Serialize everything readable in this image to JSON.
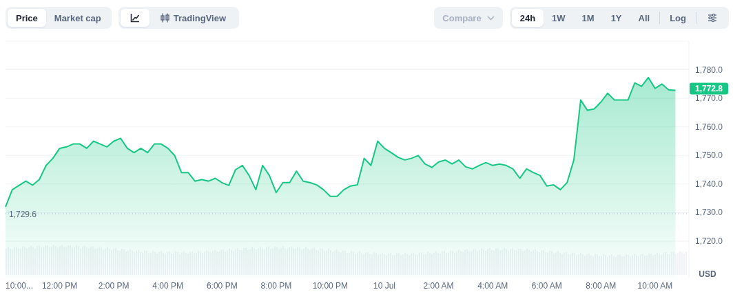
{
  "chart_type_tabs": [
    {
      "label": "Price",
      "selected": true
    },
    {
      "label": "Market cap",
      "selected": false
    }
  ],
  "view_tabs": [
    {
      "kind": "line",
      "selected": true
    },
    {
      "kind": "tradingview",
      "label": "TradingView",
      "selected": false
    }
  ],
  "compare": {
    "label": "Compare",
    "disabled": true
  },
  "range_tabs": [
    {
      "label": "24h",
      "selected": true
    },
    {
      "label": "1W",
      "selected": false
    },
    {
      "label": "1M",
      "selected": false
    },
    {
      "label": "1Y",
      "selected": false
    },
    {
      "label": "All",
      "selected": false
    }
  ],
  "scale_toggle": {
    "label": "Log"
  },
  "chart": {
    "currency": "USD",
    "price_tag": "1,772.8",
    "first_time_label": "10:00...",
    "chart_data": {
      "type": "area",
      "ylim": [
        1707,
        1790
      ],
      "categories": [
        null,
        null,
        null,
        null,
        null,
        null,
        null,
        null,
        "12:00 PM",
        null,
        null,
        null,
        null,
        null,
        null,
        null,
        "2:00 PM",
        null,
        null,
        null,
        null,
        null,
        null,
        null,
        "4:00 PM",
        null,
        null,
        null,
        null,
        null,
        null,
        null,
        "6:00 PM",
        null,
        null,
        null,
        null,
        null,
        null,
        null,
        "8:00 PM",
        null,
        null,
        null,
        null,
        null,
        null,
        null,
        "10:00 PM",
        null,
        null,
        null,
        null,
        null,
        null,
        null,
        "10 Jul",
        null,
        null,
        null,
        null,
        null,
        null,
        null,
        "2:00 AM",
        null,
        null,
        null,
        null,
        null,
        null,
        null,
        "4:00 AM",
        null,
        null,
        null,
        null,
        null,
        null,
        null,
        "6:00 AM",
        null,
        null,
        null,
        null,
        null,
        null,
        null,
        "8:00 AM",
        null,
        null,
        null,
        null,
        null,
        null,
        null,
        "10:00 AM",
        null,
        null,
        null
      ],
      "series": [
        {
          "color": "#16c784",
          "values": [
            1732,
            1738,
            1739.5,
            1741,
            1739.6,
            1741.6,
            1746.5,
            1749,
            1752.5,
            1753,
            1754,
            1754,
            1752.5,
            1755,
            1754,
            1753,
            1755,
            1756,
            1752.5,
            1751,
            1752.5,
            1751,
            1754,
            1754,
            1752.5,
            1750,
            1744,
            1744,
            1741,
            1741.6,
            1741,
            1742,
            1740.5,
            1739.5,
            1745,
            1746.5,
            1743,
            1738,
            1746.5,
            1743,
            1737,
            1740.5,
            1740.5,
            1744.5,
            1741,
            1740.5,
            1739.7,
            1738,
            1735.7,
            1735.7,
            1738,
            1739.3,
            1739.7,
            1749,
            1746.5,
            1755,
            1752.5,
            1751,
            1749.4,
            1748.4,
            1749,
            1750,
            1747,
            1745.8,
            1747.7,
            1748.4,
            1747,
            1748.4,
            1746,
            1745.3,
            1746.5,
            1747.5,
            1746.5,
            1747,
            1746.5,
            1745.3,
            1742,
            1745.3,
            1744,
            1743,
            1739.3,
            1739.7,
            1738,
            1740.5,
            1748.4,
            1769.4,
            1765.8,
            1766.3,
            1768.7,
            1771.8,
            1769.4,
            1769.4,
            1769.4,
            1775.4,
            1774.2,
            1777.3,
            1773.5,
            1775,
            1773,
            1772.8
          ]
        }
      ],
      "yticks": [
        {
          "value": 1780,
          "label": "1,780.0"
        },
        {
          "value": 1770,
          "label": "1,770.0"
        },
        {
          "value": 1760,
          "label": "1,760.0"
        },
        {
          "value": 1750,
          "label": "1,750.0"
        },
        {
          "value": 1740,
          "label": "1,740.0"
        },
        {
          "value": 1730,
          "label": "1,730.0"
        },
        {
          "value": 1720,
          "label": "1,720.0"
        }
      ],
      "grid": true,
      "ref_lines": [
        {
          "axis": "y",
          "value": 1729.6,
          "label": "1,729.6"
        }
      ]
    }
  }
}
